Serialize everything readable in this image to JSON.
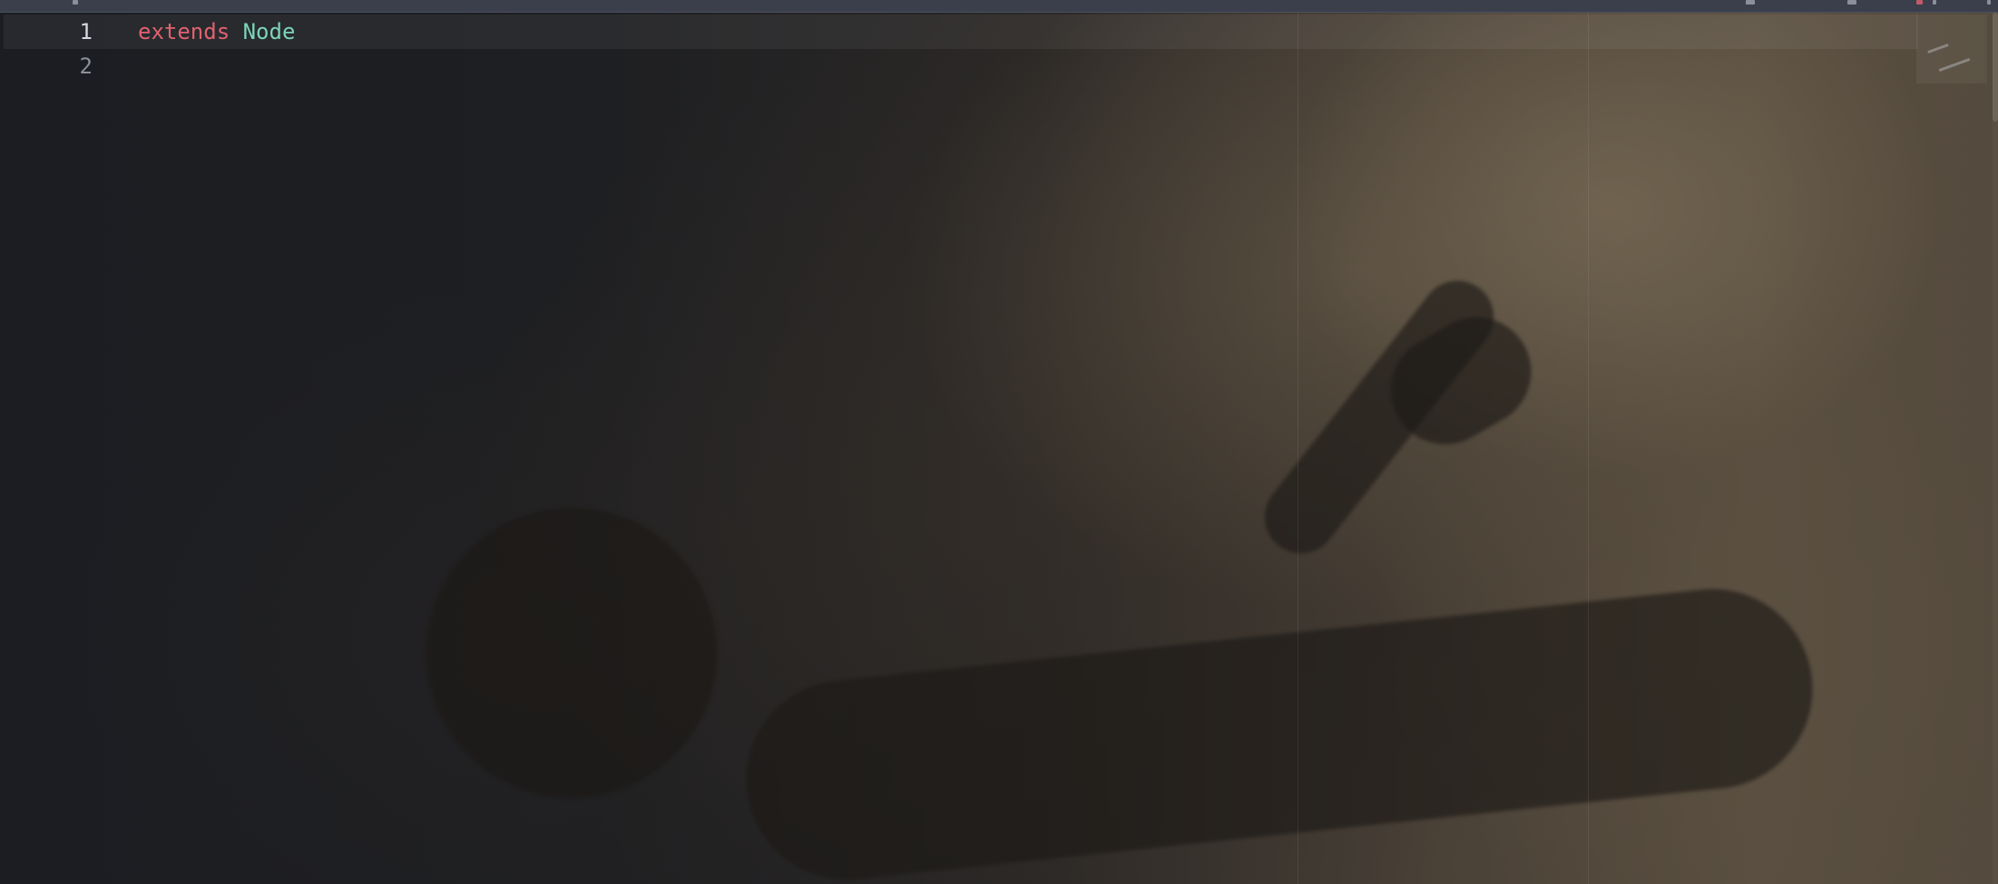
{
  "editor": {
    "line_numbers": [
      "1",
      "2"
    ],
    "active_line": 1,
    "lines": [
      {
        "keyword": "extends",
        "type": "Node"
      },
      {
        "text": ""
      }
    ]
  },
  "colors": {
    "keyword": "#e0626f",
    "type": "#7cd4b6",
    "line_number": "#8b8f98",
    "background": "#1d1f24"
  }
}
